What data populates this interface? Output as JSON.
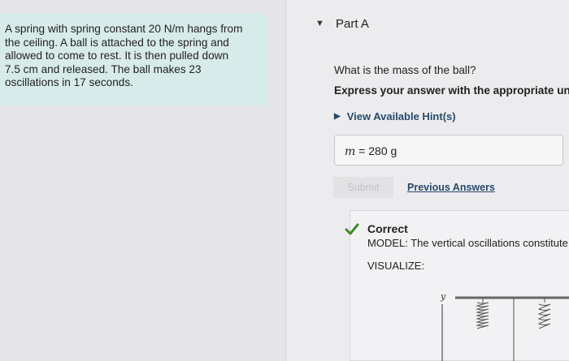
{
  "problem": {
    "lines": [
      "A spring with spring constant 20 N/m hangs from",
      "the ceiling. A ball is attached to the spring and",
      "allowed to come to rest. It is then pulled down",
      "7.5 cm and released. The ball makes 23",
      "oscillations in 17 seconds."
    ]
  },
  "part": {
    "title": "Part A",
    "question": "What is the mass of the ball?",
    "instruction": "Express your answer with the appropriate un",
    "hints_label": "View Available Hint(s)"
  },
  "answer": {
    "variable": "m",
    "equals": "=",
    "value": "280 g"
  },
  "actions": {
    "submit_label": "Submit",
    "previous_answers_label": "Previous Answers"
  },
  "feedback": {
    "status": "Correct",
    "model_text": "MODEL: The vertical oscillations constitute",
    "visualize_text": "VISUALIZE:",
    "axis_label": "y"
  },
  "colors": {
    "problem_bg": "#d8ebeb",
    "link": "#27496b",
    "check": "#3c8c2a"
  }
}
